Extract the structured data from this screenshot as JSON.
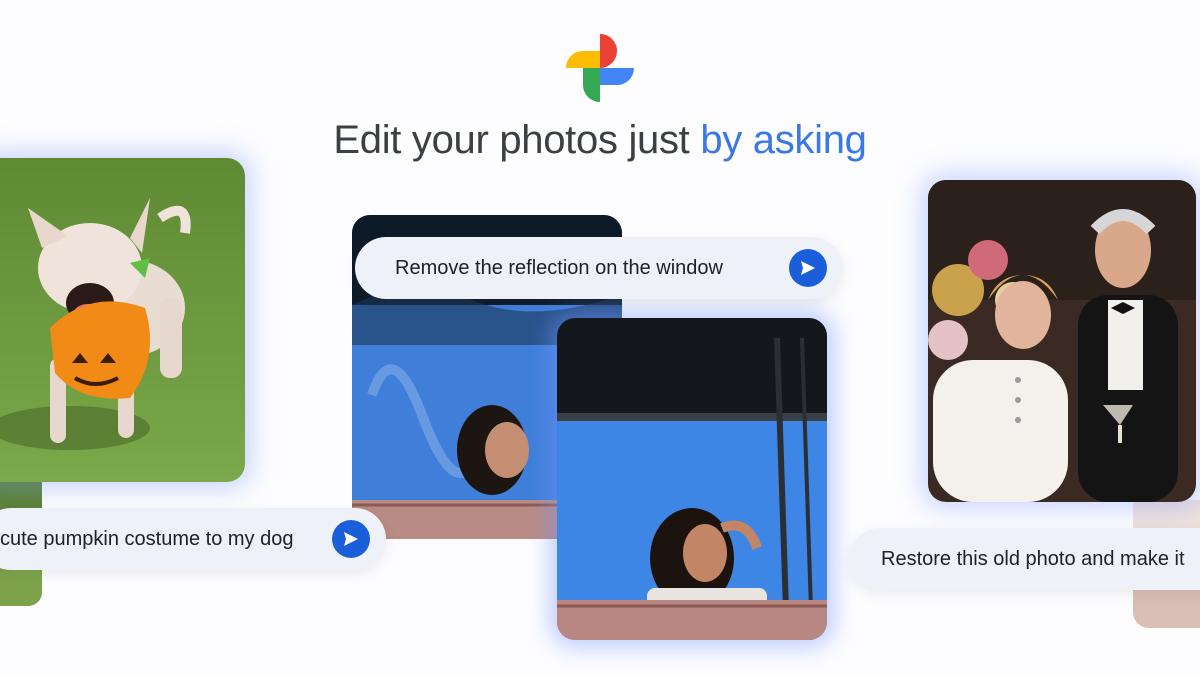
{
  "header": {
    "headline_plain": "Edit your photos just ",
    "headline_accent": "by asking",
    "logo": "google-photos-pinwheel-icon"
  },
  "prompts": [
    {
      "text": "Remove the reflection on the window",
      "icon": "send-arrow-icon"
    },
    {
      "text": "cute pumpkin costume to my dog",
      "icon": "send-arrow-icon"
    },
    {
      "text": "Restore this old photo and make it"
    }
  ],
  "photos": [
    {
      "name": "dog-pumpkin-costume-photo"
    },
    {
      "name": "window-reflection-before-photo"
    },
    {
      "name": "window-reflection-after-photo"
    },
    {
      "name": "old-couple-photo"
    }
  ],
  "colors": {
    "accent_blue": "#3b78e7",
    "send_button": "#1a5fd9",
    "chip_bg": "#eef1f7",
    "glow": "#7896ff",
    "logo_red": "#ea4335",
    "logo_yellow": "#fbbc04",
    "logo_green": "#34a853",
    "logo_blue": "#4285f4"
  }
}
